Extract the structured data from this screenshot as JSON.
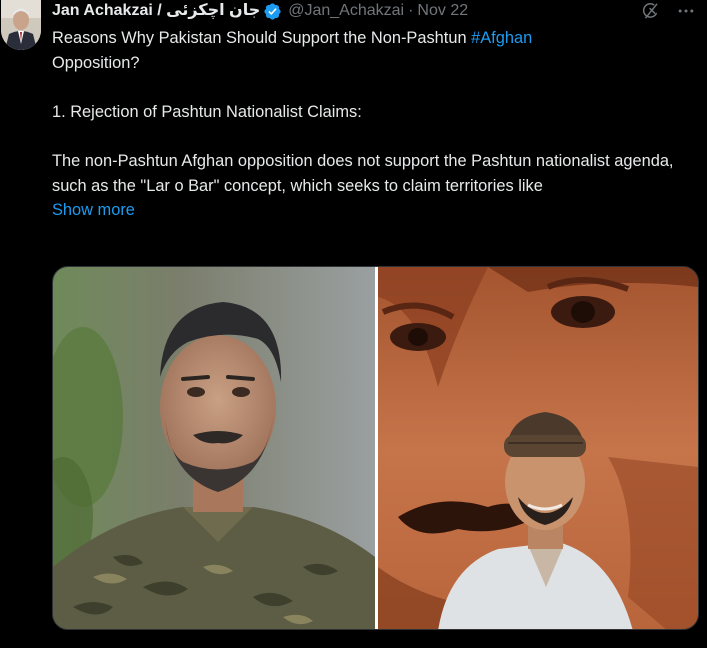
{
  "author": {
    "display_name": "Jan Achakzai / جان اچکزئی",
    "handle": "@Jan_Achakzai",
    "separator": "·",
    "date": "Nov 22",
    "verified": true,
    "verified_color": "#1d9bf0"
  },
  "header_icons": {
    "grok": "grok-icon",
    "more": "more-options-icon"
  },
  "tweet": {
    "line1_pre": "Reasons Why Pakistan Should Support the Non-Pashtun ",
    "hashtag": "#Afghan",
    "line1_post": "Opposition?",
    "point1_heading": "1. Rejection of Pashtun Nationalist Claims:",
    "point1_body": "The non-Pashtun Afghan opposition does not support the Pashtun nationalist agenda, such as the \"Lar o Bar\" concept, which seeks to claim territories like",
    "show_more": "Show more"
  },
  "colors": {
    "background": "#000000",
    "text": "#e7e9ea",
    "muted": "#71767b",
    "link": "#1d9bf0"
  }
}
